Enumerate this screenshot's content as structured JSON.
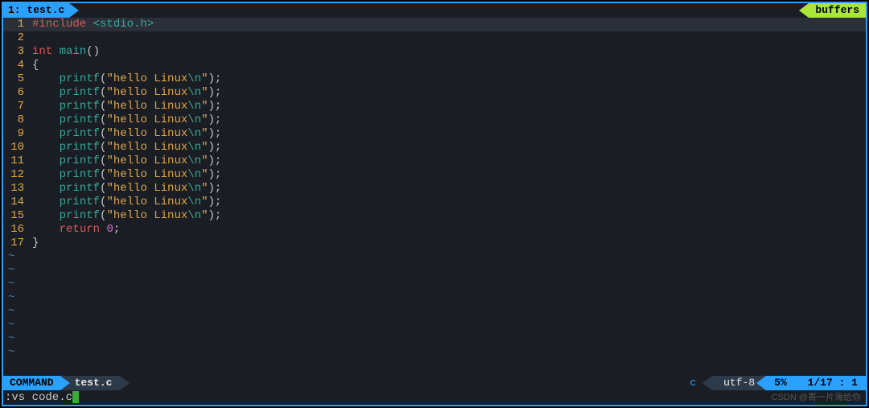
{
  "topbar": {
    "tab_label": "1: test.c",
    "buffers_label": "buffers"
  },
  "code": {
    "lines": [
      {
        "num": 1,
        "cursor": true,
        "tokens": [
          [
            "pre",
            "#include"
          ],
          [
            "id",
            " "
          ],
          [
            "hdr",
            "<stdio.h>"
          ]
        ]
      },
      {
        "num": 2,
        "tokens": []
      },
      {
        "num": 3,
        "tokens": [
          [
            "kw",
            "int"
          ],
          [
            "id",
            " "
          ],
          [
            "fn",
            "main"
          ],
          [
            "paren",
            "()"
          ]
        ]
      },
      {
        "num": 4,
        "tokens": [
          [
            "brace",
            "{"
          ]
        ]
      },
      {
        "num": 5,
        "tokens": [
          [
            "id",
            "    "
          ],
          [
            "call",
            "printf"
          ],
          [
            "paren",
            "("
          ],
          [
            "str",
            "\"hello Linux"
          ],
          [
            "esc",
            "\\n"
          ],
          [
            "str",
            "\""
          ],
          [
            "paren",
            ")"
          ],
          [
            "semi",
            ";"
          ]
        ]
      },
      {
        "num": 6,
        "tokens": [
          [
            "id",
            "    "
          ],
          [
            "call",
            "printf"
          ],
          [
            "paren",
            "("
          ],
          [
            "str",
            "\"hello Linux"
          ],
          [
            "esc",
            "\\n"
          ],
          [
            "str",
            "\""
          ],
          [
            "paren",
            ")"
          ],
          [
            "semi",
            ";"
          ]
        ]
      },
      {
        "num": 7,
        "tokens": [
          [
            "id",
            "    "
          ],
          [
            "call",
            "printf"
          ],
          [
            "paren",
            "("
          ],
          [
            "str",
            "\"hello Linux"
          ],
          [
            "esc",
            "\\n"
          ],
          [
            "str",
            "\""
          ],
          [
            "paren",
            ")"
          ],
          [
            "semi",
            ";"
          ]
        ]
      },
      {
        "num": 8,
        "tokens": [
          [
            "id",
            "    "
          ],
          [
            "call",
            "printf"
          ],
          [
            "paren",
            "("
          ],
          [
            "str",
            "\"hello Linux"
          ],
          [
            "esc",
            "\\n"
          ],
          [
            "str",
            "\""
          ],
          [
            "paren",
            ")"
          ],
          [
            "semi",
            ";"
          ]
        ]
      },
      {
        "num": 9,
        "tokens": [
          [
            "id",
            "    "
          ],
          [
            "call",
            "printf"
          ],
          [
            "paren",
            "("
          ],
          [
            "str",
            "\"hello Linux"
          ],
          [
            "esc",
            "\\n"
          ],
          [
            "str",
            "\""
          ],
          [
            "paren",
            ")"
          ],
          [
            "semi",
            ";"
          ]
        ]
      },
      {
        "num": 10,
        "tokens": [
          [
            "id",
            "    "
          ],
          [
            "call",
            "printf"
          ],
          [
            "paren",
            "("
          ],
          [
            "str",
            "\"hello Linux"
          ],
          [
            "esc",
            "\\n"
          ],
          [
            "str",
            "\""
          ],
          [
            "paren",
            ")"
          ],
          [
            "semi",
            ";"
          ]
        ]
      },
      {
        "num": 11,
        "tokens": [
          [
            "id",
            "    "
          ],
          [
            "call",
            "printf"
          ],
          [
            "paren",
            "("
          ],
          [
            "str",
            "\"hello Linux"
          ],
          [
            "esc",
            "\\n"
          ],
          [
            "str",
            "\""
          ],
          [
            "paren",
            ")"
          ],
          [
            "semi",
            ";"
          ]
        ]
      },
      {
        "num": 12,
        "tokens": [
          [
            "id",
            "    "
          ],
          [
            "call",
            "printf"
          ],
          [
            "paren",
            "("
          ],
          [
            "str",
            "\"hello Linux"
          ],
          [
            "esc",
            "\\n"
          ],
          [
            "str",
            "\""
          ],
          [
            "paren",
            ")"
          ],
          [
            "semi",
            ";"
          ]
        ]
      },
      {
        "num": 13,
        "tokens": [
          [
            "id",
            "    "
          ],
          [
            "call",
            "printf"
          ],
          [
            "paren",
            "("
          ],
          [
            "str",
            "\"hello Linux"
          ],
          [
            "esc",
            "\\n"
          ],
          [
            "str",
            "\""
          ],
          [
            "paren",
            ")"
          ],
          [
            "semi",
            ";"
          ]
        ]
      },
      {
        "num": 14,
        "tokens": [
          [
            "id",
            "    "
          ],
          [
            "call",
            "printf"
          ],
          [
            "paren",
            "("
          ],
          [
            "str",
            "\"hello Linux"
          ],
          [
            "esc",
            "\\n"
          ],
          [
            "str",
            "\""
          ],
          [
            "paren",
            ")"
          ],
          [
            "semi",
            ";"
          ]
        ]
      },
      {
        "num": 15,
        "tokens": [
          [
            "id",
            "    "
          ],
          [
            "call",
            "printf"
          ],
          [
            "paren",
            "("
          ],
          [
            "str",
            "\"hello Linux"
          ],
          [
            "esc",
            "\\n"
          ],
          [
            "str",
            "\""
          ],
          [
            "paren",
            ")"
          ],
          [
            "semi",
            ";"
          ]
        ]
      },
      {
        "num": 16,
        "tokens": [
          [
            "id",
            "    "
          ],
          [
            "kw",
            "return"
          ],
          [
            "id",
            " "
          ],
          [
            "num",
            "0"
          ],
          [
            "semi",
            ";"
          ]
        ]
      },
      {
        "num": 17,
        "tokens": [
          [
            "brace",
            "}"
          ]
        ]
      }
    ],
    "tilde_rows": 8
  },
  "status": {
    "mode": "COMMAND",
    "filename": "test.c",
    "filetype": "c",
    "encoding": "utf-8",
    "percent": "5%",
    "position": "1/17 :  1"
  },
  "cmdline": {
    "text": ":vs code.c"
  },
  "watermark": "CSDN @寄一片海给你"
}
